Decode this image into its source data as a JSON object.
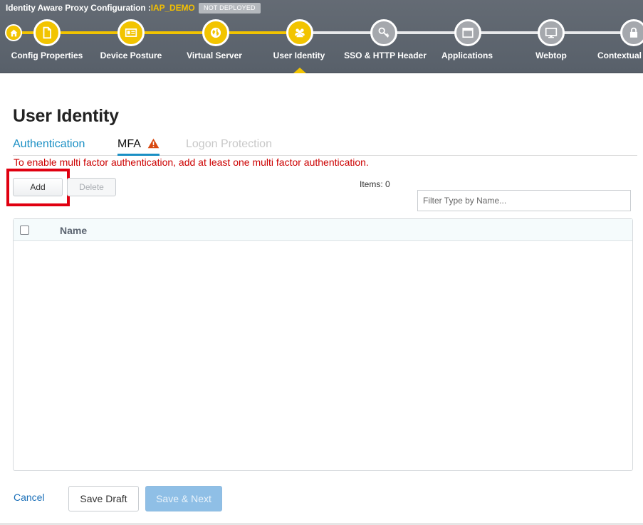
{
  "header": {
    "title_prefix": "Identity Aware Proxy Configuration :",
    "config_name": "IAP_DEMO",
    "deploy_status": "NOT DEPLOYED"
  },
  "wizard": {
    "home_icon": "home-icon",
    "active_step": "User Identity",
    "steps": [
      {
        "label": "Config Properties",
        "icon": "document-icon",
        "state": "done"
      },
      {
        "label": "Device Posture",
        "icon": "id-card-icon",
        "state": "done"
      },
      {
        "label": "Virtual Server",
        "icon": "globe-icon",
        "state": "done"
      },
      {
        "label": "User Identity",
        "icon": "users-icon",
        "state": "active"
      },
      {
        "label": "SSO & HTTP Header",
        "icon": "key-icon",
        "state": "todo"
      },
      {
        "label": "Applications",
        "icon": "window-icon",
        "state": "todo"
      },
      {
        "label": "Webtop",
        "icon": "monitor-icon",
        "state": "todo"
      },
      {
        "label": "Contextual",
        "icon": "lock-icon",
        "state": "todo"
      }
    ]
  },
  "page": {
    "title": "User Identity",
    "tabs": {
      "authentication": "Authentication",
      "mfa": "MFA",
      "logon_protection": "Logon Protection"
    },
    "active_tab": "MFA",
    "error_message": "To enable multi factor authentication, add at least one multi factor authentication."
  },
  "toolbar": {
    "add_label": "Add",
    "delete_label": "Delete",
    "items_count": "Items: 0",
    "filter_placeholder": "Filter Type by Name..."
  },
  "grid": {
    "columns": [
      "Name"
    ],
    "rows": []
  },
  "footer": {
    "cancel_label": "Cancel",
    "save_draft_label": "Save Draft",
    "save_next_label": "Save & Next"
  },
  "colors": {
    "accent_yellow": "#f2c400",
    "link_blue": "#1a8fc4",
    "error_red": "#cc0000",
    "highlight_red": "#e00010"
  }
}
